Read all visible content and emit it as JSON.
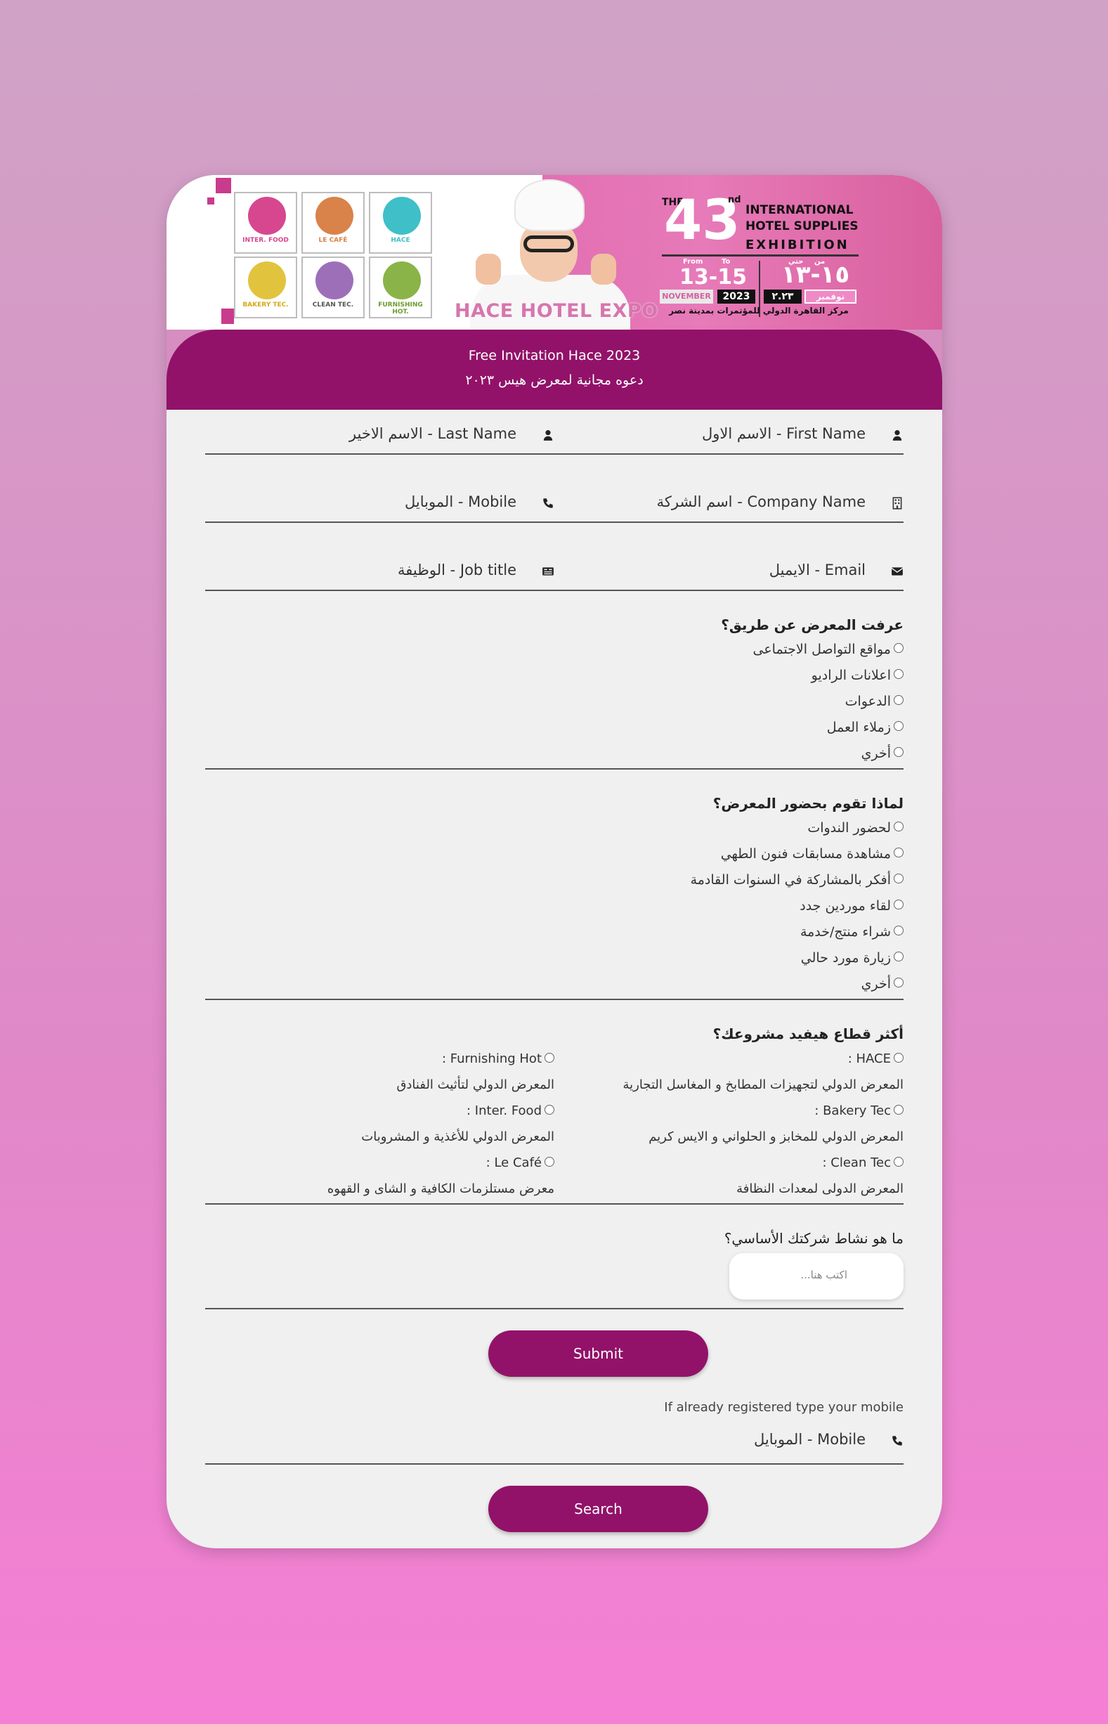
{
  "banner": {
    "tiles": [
      {
        "label": "INTER. FOOD",
        "color": "#d6478f"
      },
      {
        "label": "LE CAFÉ",
        "color": "#d9824a"
      },
      {
        "label": "HACE",
        "color": "#3fbfc8"
      },
      {
        "label": "BAKERY TEC.",
        "color": "#e2c33e"
      },
      {
        "label": "CLEAN TEC.",
        "color": "#9d6fb8"
      },
      {
        "label": "FURNISHING HOT.",
        "color": "#8ab448"
      }
    ],
    "expo_name": "HACE HOTEL EXPO",
    "the": "THE",
    "edition_number": "43",
    "edition_suffix": "nd",
    "title_line1": "INTERNATIONAL",
    "title_line2": "HOTEL SUPPLIES",
    "title_line3": "EXHIBITION",
    "from_label": "From",
    "to_label": "To",
    "from_label_ar": "من",
    "to_label_ar": "حتي",
    "dates_en": "13-15",
    "dates_ar": "١٥-١٣",
    "month_en": "NOVEMBER",
    "year_en": "2023",
    "year_ar": "٢.٢٣",
    "month_ar": "نوفمبر",
    "venue_ar": "مركز القاهرة الدولي للمؤتمرات بمدينة نصر"
  },
  "header": {
    "title": "Free Invitation Hace 2023",
    "subtitle": "دعوه مجانية لمعرض هيس ٢٠٢٣"
  },
  "fields": {
    "first_name": "First Name - الاسم الاول",
    "last_name": "Last Name - الاسم الاخير",
    "company": "Company Name - اسم الشركة",
    "mobile": "Mobile - الموبايل",
    "email": "Email - الايميل",
    "job": "Job title - الوظيفة"
  },
  "q1": {
    "title": "عرفت المعرض عن طريق؟",
    "options": [
      "مواقع التواصل الاجتماعى",
      "اعلانات الراديو",
      "الدعوات",
      "زملاء العمل",
      "أخري"
    ]
  },
  "q2": {
    "title": "لماذا تقوم بحضور المعرض؟",
    "options": [
      "لحضور الندوات",
      "مشاهدة مسابقات فنون الطهي",
      "أفكر بالمشاركة في السنوات القادمة",
      "لقاء موردين جدد",
      "شراء منتج/خدمة",
      "زيارة مورد حالي",
      "أخري"
    ]
  },
  "q3": {
    "title": "أكثر قطاع هيفيد مشروعك؟",
    "sectors": [
      {
        "name": "HACE :",
        "desc": "المعرض الدولي لتجهيزات المطابخ و المغاسل التجارية"
      },
      {
        "name": "Furnishing Hot :",
        "desc": "المعرض الدولي لتأثيث الفنادق"
      },
      {
        "name": "Bakery Tec :",
        "desc": "المعرض الدولي للمخابز و الحلواني و الايس كريم"
      },
      {
        "name": "Inter. Food :",
        "desc": "المعرض الدولي للأغذية و المشروبات"
      },
      {
        "name": "Clean Tec :",
        "desc": "المعرض الدولى لمعدات النظافة"
      },
      {
        "name": "Le Café :",
        "desc": "معرض مستلزمات الكافية و الشاى و القهوه"
      }
    ]
  },
  "q4": {
    "title": "ما هو نشاط شركتك الأساسي؟",
    "placeholder": "اكتب هنا..."
  },
  "submit_label": "Submit",
  "registered_note": "If already registered type your mobile",
  "search_mobile": "Mobile - الموبايل",
  "search_label": "Search"
}
